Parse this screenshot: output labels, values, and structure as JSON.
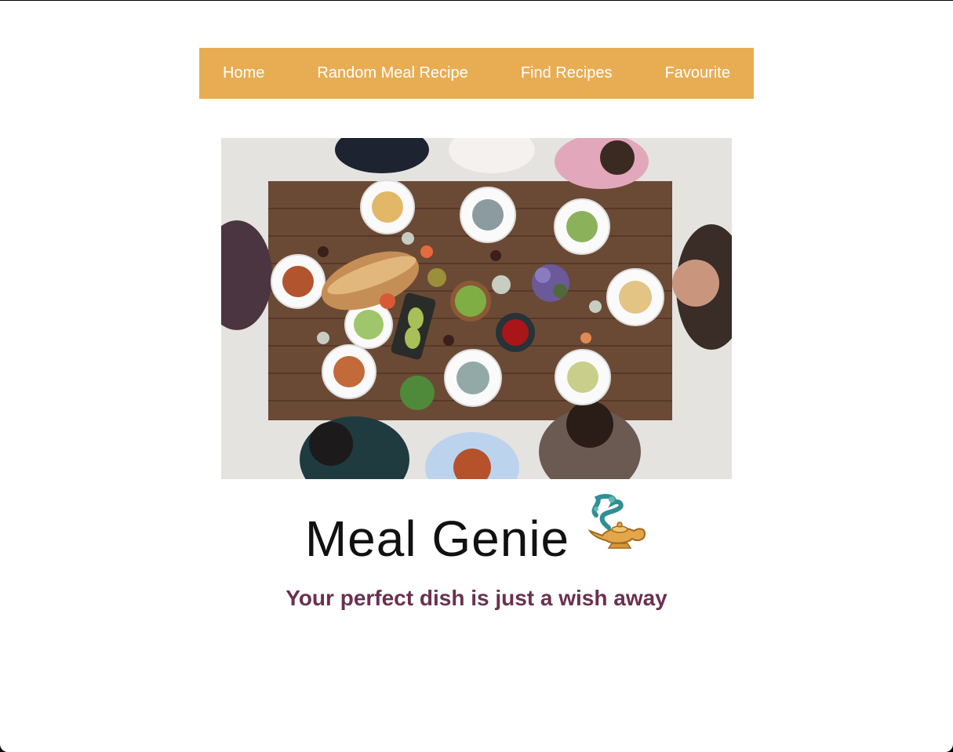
{
  "nav": {
    "items": [
      {
        "label": "Home"
      },
      {
        "label": "Random Meal Recipe"
      },
      {
        "label": "Find Recipes"
      },
      {
        "label": "Favourite"
      }
    ]
  },
  "hero": {
    "icon": "dinner-table-photo"
  },
  "header": {
    "title": "Meal Genie",
    "icon": "genie-lamp-icon",
    "tagline": "Your perfect dish is just a wish away"
  },
  "colors": {
    "nav_bg": "#e8ad52",
    "nav_text": "#ffffff",
    "tagline": "#6b3050",
    "title": "#111111"
  }
}
